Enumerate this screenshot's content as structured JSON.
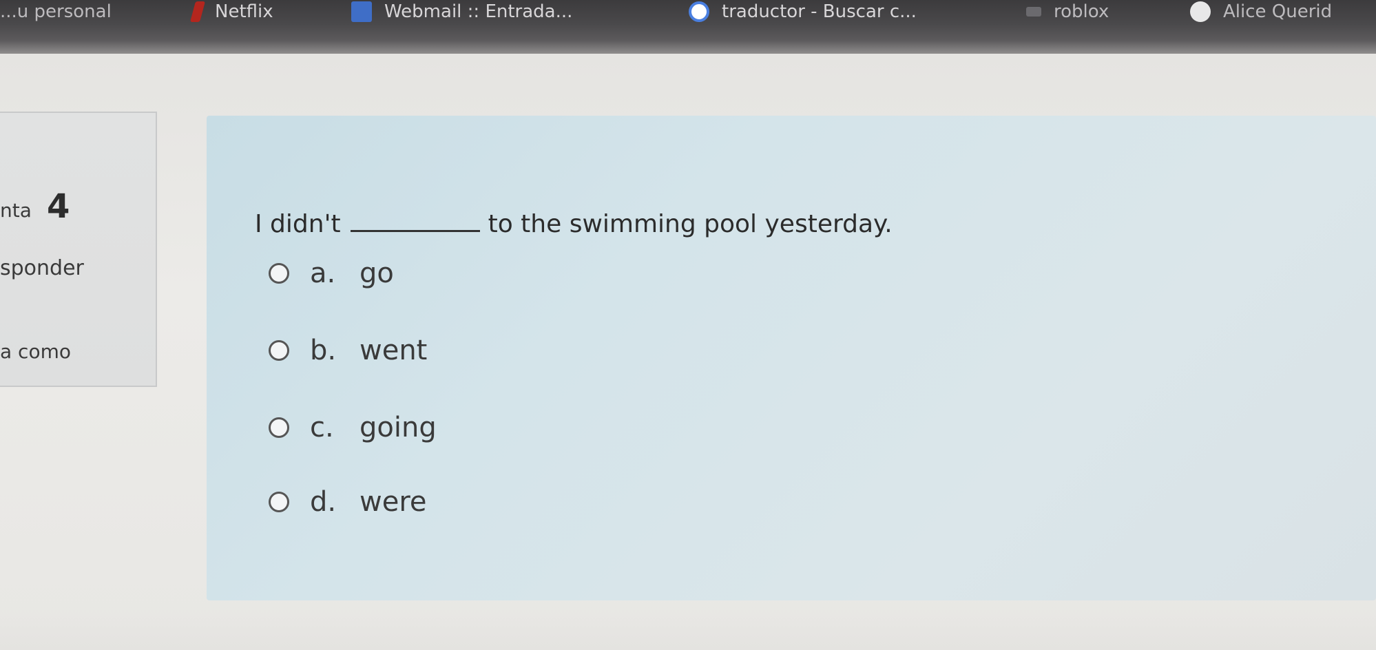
{
  "browser": {
    "bookmarks": [
      {
        "label": "...u personal",
        "icon": "bookmark-icon"
      },
      {
        "label": "Netflix",
        "icon": "netflix-icon"
      },
      {
        "label": "Webmail :: Entrada...",
        "icon": "webmail-icon"
      },
      {
        "label": "traductor - Buscar c...",
        "icon": "google-icon"
      },
      {
        "label": "roblox",
        "icon": "roblox-icon"
      },
      {
        "label": "Alice Querid",
        "icon": "globe-icon"
      }
    ]
  },
  "sidebar": {
    "question_prefix": "nta",
    "question_number": "4",
    "status_label": "sponder",
    "mark_label": "a como"
  },
  "question": {
    "text_before": "I didn't",
    "text_after": "to the swimming pool yesterday.",
    "options": [
      {
        "letter": "a.",
        "text": "go"
      },
      {
        "letter": "b.",
        "text": "went"
      },
      {
        "letter": "c.",
        "text": "going"
      },
      {
        "letter": "d.",
        "text": "were"
      }
    ]
  },
  "colors": {
    "accent_card": "#cfe0e7",
    "bookmarks_bar": "#4a494b"
  }
}
